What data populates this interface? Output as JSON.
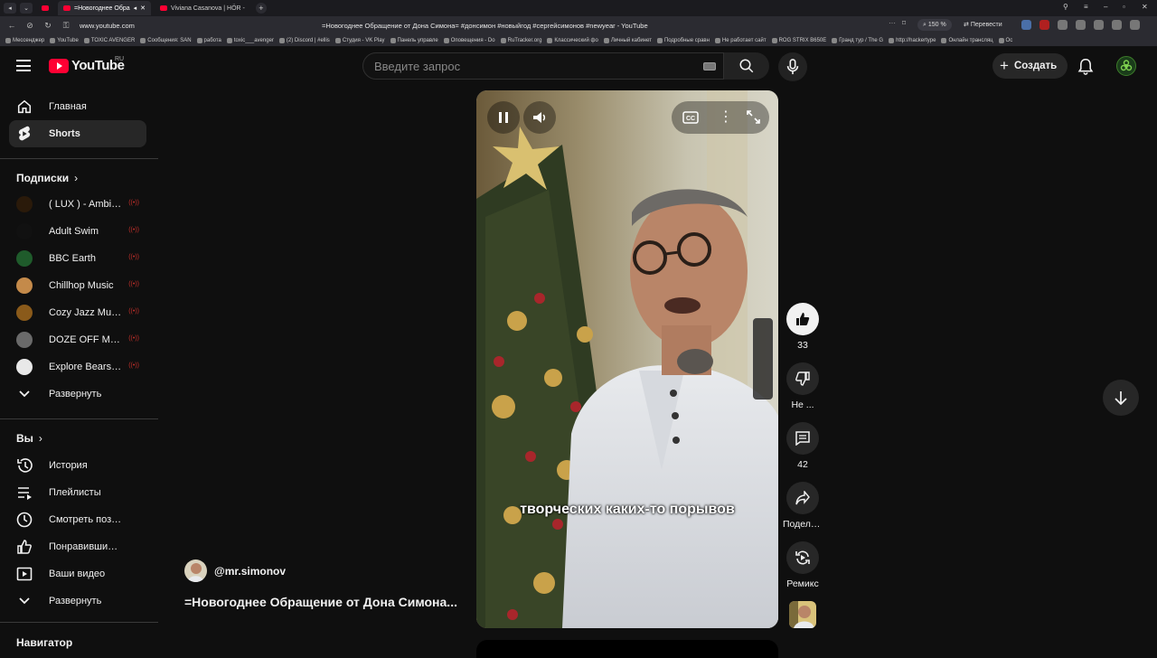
{
  "browser": {
    "tabs": [
      {
        "title": "=Новогоднее Обра",
        "active": true
      },
      {
        "title": "Viviana Casanova | HÖR -",
        "active": false
      }
    ],
    "url": "www.youtube.com",
    "page_title": "=Новогоднее Обращение от Дона Симона= #донсимон #новыйгод #сергейсимонов #newyear - YouTube",
    "zoom": "150 %",
    "translate_label": "Перевести",
    "bookmarks": [
      "Мессенджер",
      "YouTube",
      "TOXIC AVENGER",
      "Сообщения: SAN",
      "работа",
      "toxic___avenger",
      "(2) Discord | #ellis",
      "Студия - VK Play",
      "Панель управле",
      "Оповещения - Do",
      "RuTracker.org",
      "Классический фо",
      "Личный кабинет",
      "Подробные сравн",
      "Не работает сайт",
      "ROG STRIX B650E",
      "Гранд тур / The G",
      "http://hackertype",
      "Онлайн трансляц",
      "Ос"
    ]
  },
  "header": {
    "logo_text": "YouTube",
    "region": "RU",
    "search_placeholder": "Введите запрос",
    "create_label": "Создать"
  },
  "sidebar": {
    "main": [
      {
        "label": "Главная",
        "icon": "home-icon"
      },
      {
        "label": "Shorts",
        "icon": "shorts-icon",
        "active": true
      }
    ],
    "subscriptions_title": "Подписки",
    "subscriptions": [
      {
        "label": "( LUX ) - Ambient...",
        "color": "#2a1a0a"
      },
      {
        "label": "Adult Swim",
        "color": "#111111"
      },
      {
        "label": "BBC Earth",
        "color": "#1f5b2b"
      },
      {
        "label": "Chillhop Music",
        "color": "#c48a4a"
      },
      {
        "label": "Cozy Jazz Music",
        "color": "#8a5a1a"
      },
      {
        "label": "DOZE OFF MEDU...",
        "color": "#6a6a6a"
      },
      {
        "label": "Explore Bears & ...",
        "color": "#e8e8e8"
      }
    ],
    "subs_expand": "Развернуть",
    "you_title": "Вы",
    "you_items": [
      {
        "label": "История",
        "icon": "history-icon"
      },
      {
        "label": "Плейлисты",
        "icon": "playlists-icon"
      },
      {
        "label": "Смотреть позже",
        "icon": "watch-later-icon"
      },
      {
        "label": "Понравившиеся",
        "icon": "liked-icon"
      },
      {
        "label": "Ваши видео",
        "icon": "your-videos-icon"
      }
    ],
    "you_expand": "Развернуть",
    "navigator_title": "Навигатор"
  },
  "short": {
    "caption": "творческих каких-то порывов",
    "channel": "@mr.simonov",
    "title": "=Новогоднее Обращение от Дона Симона...",
    "likes": "33",
    "dislike_label": "Не ...",
    "comments": "42",
    "share_label": "Поделиться",
    "remix_label": "Ремикс"
  }
}
